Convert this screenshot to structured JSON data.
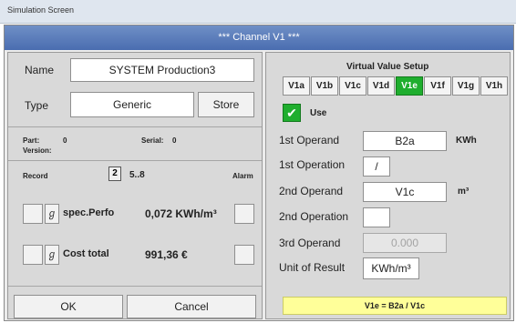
{
  "window": {
    "title": "Simulation Screen",
    "header": "***  Channel V1  ***"
  },
  "name": {
    "label": "Name",
    "value": "SYSTEM Production3"
  },
  "type": {
    "label": "Type",
    "value": "Generic",
    "store_button": "Store"
  },
  "info": {
    "part_label": "Part:",
    "part_value": "0",
    "serial_label": "Serial:",
    "serial_value": "0",
    "version_label": "Version:"
  },
  "record": {
    "label": "Record",
    "range": "5..8",
    "alarm_label": "Alarm"
  },
  "rows": [
    {
      "label": "spec.Perfo",
      "value": "0,072 KWh/m³"
    },
    {
      "label": "Cost total",
      "value": "991,36 €"
    }
  ],
  "footer": {
    "ok": "OK",
    "cancel": "Cancel"
  },
  "setup": {
    "title": "Virtual Value Setup",
    "buttons": [
      "V1a",
      "V1b",
      "V1c",
      "V1d",
      "V1e",
      "V1f",
      "V1g",
      "V1h"
    ],
    "active": "V1e",
    "use_label": "Use",
    "first_operand": {
      "label": "1st Operand",
      "value": "B2a",
      "unit": "KWh"
    },
    "first_operation": {
      "label": "1st Operation",
      "value": "/"
    },
    "second_operand": {
      "label": "2nd Operand",
      "value": "V1c",
      "unit": "m³"
    },
    "second_operation": {
      "label": "2nd Operation",
      "value": ""
    },
    "third_operand": {
      "label": "3rd Operand",
      "value": "0.000"
    },
    "unit_result": {
      "label": "Unit of Result",
      "value": "KWh/m³"
    },
    "formula": "V1e = B2a / V1c"
  },
  "colors": {
    "header": "#5779b8",
    "active_button": "#1fae2e",
    "formula_bg": "#ffff99"
  }
}
